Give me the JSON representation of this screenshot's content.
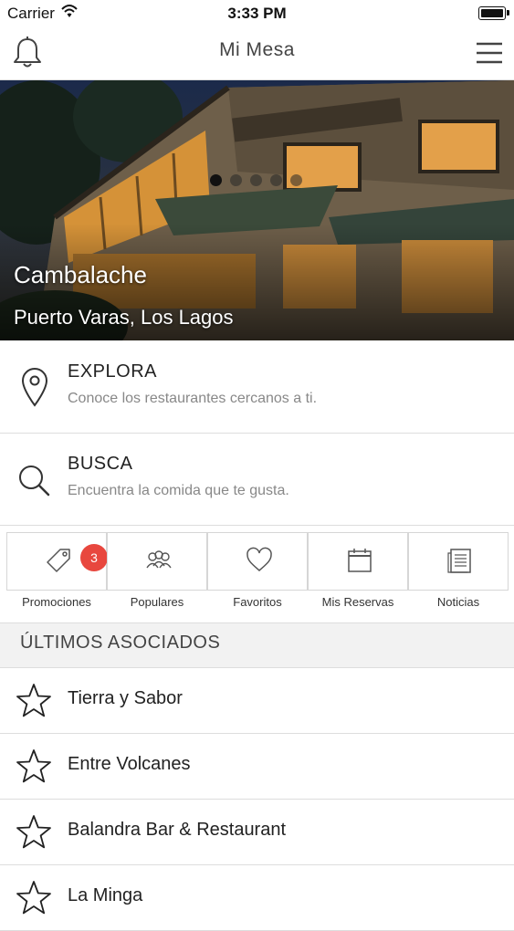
{
  "status_bar": {
    "carrier": "Carrier",
    "time": "3:33 PM"
  },
  "nav": {
    "title": "Mi Mesa",
    "left_icon": "bell-icon",
    "right_icon": "hamburger-menu-icon"
  },
  "hero": {
    "restaurant_name": "Cambalache",
    "location": "Puerto Varas, Los Lagos",
    "page_dots": 5,
    "active_dot": 1
  },
  "menu_rows": [
    {
      "title": "EXPLORA",
      "subtitle": "Conoce los restaurantes cercanos a ti.",
      "icon": "location-pin-icon"
    },
    {
      "title": "BUSCA",
      "subtitle": "Encuentra la comida que te gusta.",
      "icon": "search-icon"
    }
  ],
  "quick_actions": [
    {
      "label": "Promociones",
      "icon": "tag-icon",
      "badge": "3"
    },
    {
      "label": "Populares",
      "icon": "people-icon"
    },
    {
      "label": "Favoritos",
      "icon": "heart-icon"
    },
    {
      "label": "Mis Reservas",
      "icon": "calendar-icon"
    },
    {
      "label": "Noticias",
      "icon": "news-icon"
    }
  ],
  "section": {
    "title": "ÚLTIMOS ASOCIADOS"
  },
  "associates": [
    {
      "name": "Tierra y Sabor"
    },
    {
      "name": "Entre Volcanes"
    },
    {
      "name": "Balandra Bar & Restaurant"
    },
    {
      "name": "La Minga"
    }
  ],
  "colors": {
    "badge": "#e8473e",
    "section_bg": "#f2f2f2",
    "divider": "#dddddd"
  }
}
